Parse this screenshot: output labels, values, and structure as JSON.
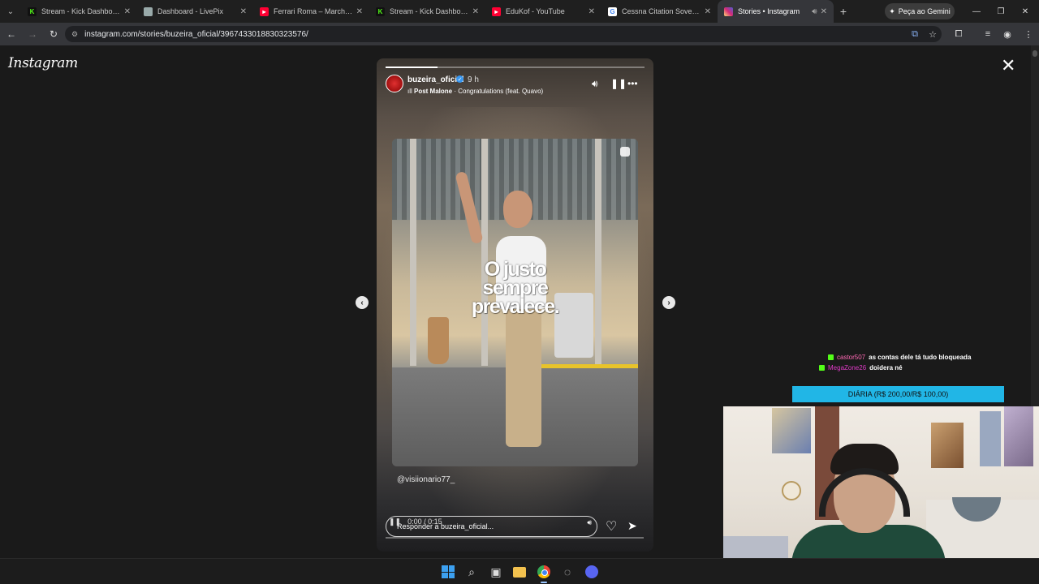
{
  "browser": {
    "tabs": [
      {
        "title": "Stream - Kick Dashboard",
        "favicon": "kick-icon"
      },
      {
        "title": "Dashboard - LivePix",
        "favicon": "livepix-icon"
      },
      {
        "title": "Ferrari Roma – Marcha e Pu",
        "favicon": "youtube-icon"
      },
      {
        "title": "Stream - Kick Dashboard",
        "favicon": "kick-icon"
      },
      {
        "title": "EduKof - YouTube",
        "favicon": "youtube-icon"
      },
      {
        "title": "Cessna Citation Sovereign -",
        "favicon": "google-icon"
      },
      {
        "title": "Stories • Instagram",
        "favicon": "instagram-icon",
        "active": true
      }
    ],
    "gemini_label": "Peça ao Gemini",
    "url": "instagram.com/stories/buzeira_oficial/3967433018830323576/"
  },
  "instagram": {
    "logo": "Instagram",
    "story": {
      "username": "buzeira_oficial",
      "time_ago": "9 h",
      "music_artist": "Post Malone",
      "music_title": "Congratulations (feat. Quavo)",
      "caption": "O justo\nsempre\nprevalece.",
      "mention": "@visiionario77_",
      "video_time": "0:00 / 0:15",
      "reply_placeholder": "Responder a buzeira_oficial...",
      "progress": 0.2
    }
  },
  "stream_overlay": {
    "chat": [
      {
        "user": "castor507",
        "message": "as contas dele tá tudo bloqueada"
      },
      {
        "user": "MegaZone26",
        "message": "doidera né"
      }
    ],
    "banner": "DIÁRIA (R$ 200,00/R$ 100,00)"
  },
  "colors": {
    "kick_green": "#53fc18",
    "banner_blue": "#21b6e6",
    "ig_verified": "#3897f0"
  }
}
